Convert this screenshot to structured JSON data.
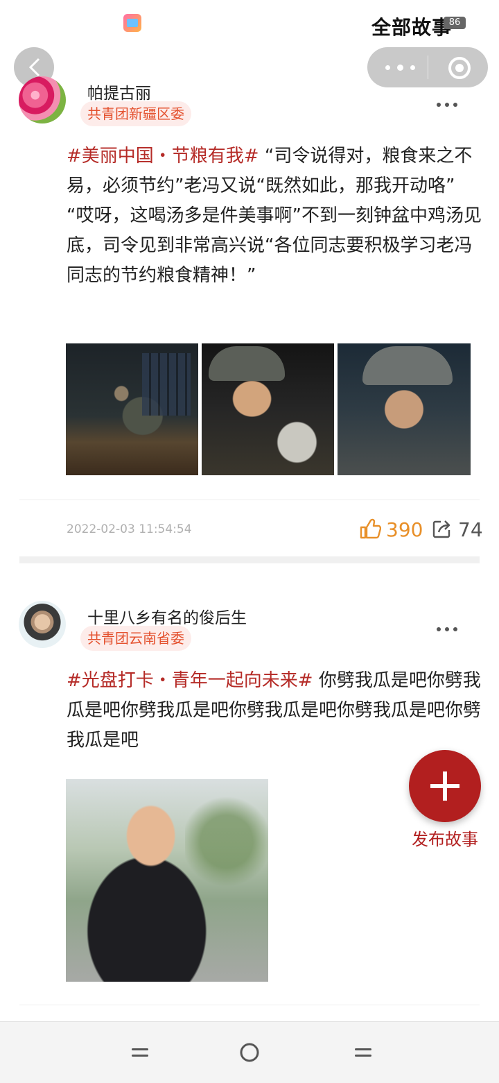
{
  "status_bar": {
    "title": "全部故事",
    "battery": "86"
  },
  "nav": {
    "back_icon": "chevron-left-icon",
    "more_icon": "more-dots-icon",
    "close_icon": "target-icon"
  },
  "posts": [
    {
      "username": "帕提古丽",
      "org": "共青团新疆区委",
      "hashtag": "#美丽中国・节粮有我#",
      "text": " “司令说得对，粮食来之不易，必须节约”老冯又说“既然如此，那我开动咯” “哎呀，这喝汤多是件美事啊”不到一刻钟盆中鸡汤见底，司令见到非常高兴说“各位同志要积极学习老冯同志的节约粮食精神！”",
      "timestamp": "2022-02-03 11:54:54",
      "likes": "390",
      "shares": "74"
    },
    {
      "username": "十里八乡有名的俊后生",
      "org": "共青团云南省委",
      "hashtag": "#光盘打卡・青年一起向未来#",
      "text": " 你劈我瓜是吧你劈我瓜是吧你劈我瓜是吧你劈我瓜是吧你劈我瓜是吧你劈我瓜是吧"
    }
  ],
  "fab": {
    "label": "发布故事"
  },
  "colors": {
    "accent": "#b21f1f",
    "hashtag": "#b52b27",
    "like": "#e8902a",
    "tag_bg": "#fdecea",
    "tag_text": "#e4512e"
  }
}
